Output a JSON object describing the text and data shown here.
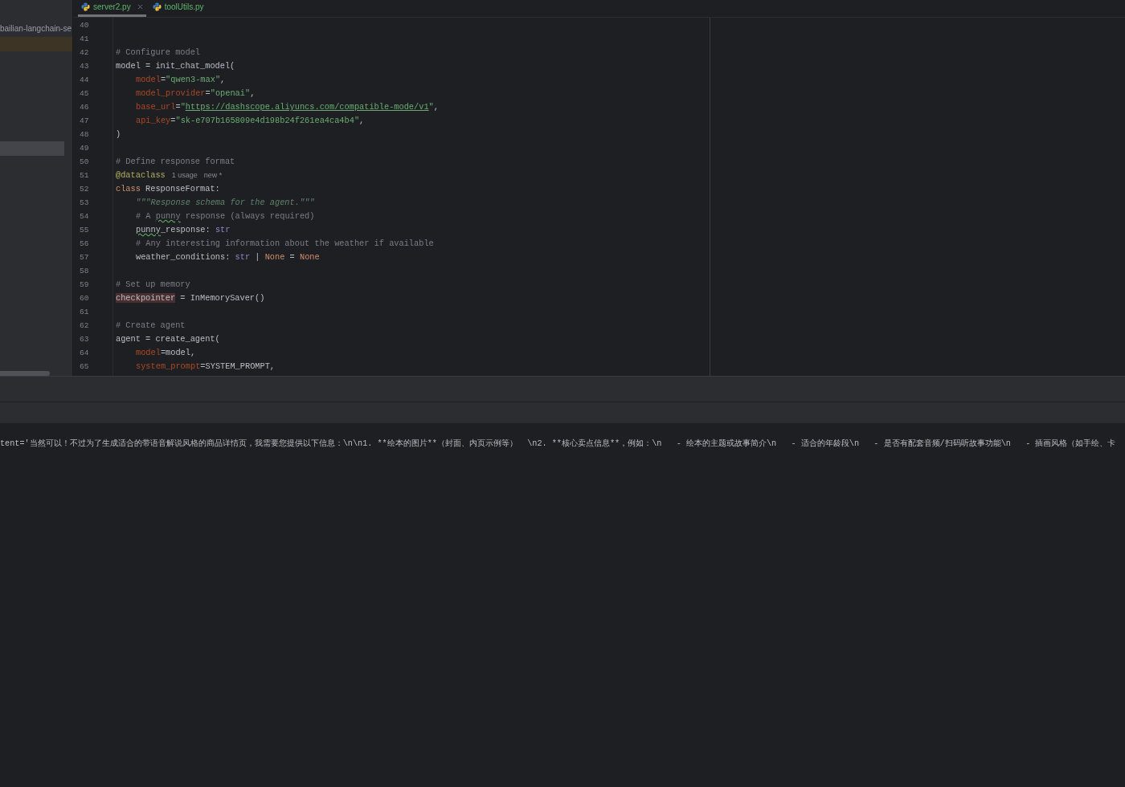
{
  "tabs": [
    {
      "label": "server2.py",
      "selected": true,
      "closable": true
    },
    {
      "label": "toolUtils.py",
      "selected": false,
      "closable": false
    }
  ],
  "project_tree": {
    "root_label": "bailian-langchain-se",
    "rows": [
      {
        "selected": false
      },
      {
        "selected": true
      }
    ]
  },
  "editor": {
    "lines": [
      {
        "number": "40"
      },
      {
        "number": "41"
      },
      {
        "number": "42",
        "indented": false,
        "tokens": [
          {
            "t": "# Configure model",
            "kind": "comment"
          }
        ]
      },
      {
        "number": "43",
        "indented": false,
        "tokens": [
          {
            "t": "model = init_chat_model(",
            "kind": "plain"
          }
        ]
      },
      {
        "number": "44",
        "indented": true,
        "tokens": [
          {
            "t": "model",
            "kind": "param"
          },
          {
            "t": "=",
            "kind": "plain"
          },
          {
            "t": "\"qwen3-max\"",
            "kind": "string"
          },
          {
            "t": ",",
            "kind": "plain"
          }
        ]
      },
      {
        "number": "45",
        "indented": true,
        "tokens": [
          {
            "t": "model_provider",
            "kind": "param"
          },
          {
            "t": "=",
            "kind": "plain"
          },
          {
            "t": "\"openai\"",
            "kind": "string"
          },
          {
            "t": ",",
            "kind": "plain"
          }
        ]
      },
      {
        "number": "46",
        "indented": true,
        "tokens": [
          {
            "t": "base_url",
            "kind": "param"
          },
          {
            "t": "=",
            "kind": "plain"
          },
          {
            "t": "\"",
            "kind": "string"
          },
          {
            "t": "https://dashscope.aliyuncs.com/compatible-mode/v1",
            "kind": "url"
          },
          {
            "t": "\"",
            "kind": "string"
          },
          {
            "t": ",",
            "kind": "plain"
          }
        ]
      },
      {
        "number": "47",
        "indented": true,
        "tokens": [
          {
            "t": "api_key",
            "kind": "param"
          },
          {
            "t": "=",
            "kind": "plain"
          },
          {
            "t": "\"sk-e707b165809e4d198b24f261ea4ca4b4\"",
            "kind": "string"
          },
          {
            "t": ",",
            "kind": "plain"
          }
        ]
      },
      {
        "number": "48",
        "indented": false,
        "tokens": [
          {
            "t": ")",
            "kind": "plain"
          }
        ]
      },
      {
        "number": "49"
      },
      {
        "number": "50",
        "indented": false,
        "tokens": [
          {
            "t": "# Define response format",
            "kind": "comment"
          }
        ]
      },
      {
        "number": "51",
        "indented": false,
        "tokens": [
          {
            "t": "@dataclass",
            "kind": "decorator"
          },
          {
            "t": "1 usage",
            "kind": "hint"
          },
          {
            "t": "new *",
            "kind": "hint"
          }
        ]
      },
      {
        "number": "52",
        "indented": false,
        "tokens": [
          {
            "t": "class",
            "kind": "keyword"
          },
          {
            "t": " ResponseFormat:",
            "kind": "plain"
          }
        ]
      },
      {
        "number": "53",
        "indented": true,
        "tokens": [
          {
            "t": "\"\"\"Response schema for the agent.\"\"\"",
            "kind": "docstring"
          }
        ]
      },
      {
        "number": "54",
        "indented": true,
        "tokens": [
          {
            "t": "# A ",
            "kind": "comment"
          },
          {
            "t": "punny",
            "kind": "typo_comment"
          },
          {
            "t": " response (always required)",
            "kind": "comment"
          }
        ]
      },
      {
        "number": "55",
        "indented": true,
        "tokens": [
          {
            "t": "punny",
            "kind": "typo"
          },
          {
            "t": "_response: ",
            "kind": "plain"
          },
          {
            "t": "str",
            "kind": "builtin"
          }
        ]
      },
      {
        "number": "56",
        "indented": true,
        "tokens": [
          {
            "t": "# Any interesting information about the weather if available",
            "kind": "comment"
          }
        ]
      },
      {
        "number": "57",
        "indented": true,
        "tokens": [
          {
            "t": "weather_conditions: ",
            "kind": "plain"
          },
          {
            "t": "str",
            "kind": "builtin"
          },
          {
            "t": " | ",
            "kind": "plain"
          },
          {
            "t": "None",
            "kind": "const"
          },
          {
            "t": " = ",
            "kind": "plain"
          },
          {
            "t": "None",
            "kind": "const"
          }
        ]
      },
      {
        "number": "58"
      },
      {
        "number": "59",
        "indented": false,
        "tokens": [
          {
            "t": "# Set up memory",
            "kind": "comment"
          }
        ]
      },
      {
        "number": "60",
        "indented": false,
        "tokens": [
          {
            "t": "checkpointer",
            "kind": "marked"
          },
          {
            "t": " = InMemorySaver()",
            "kind": "plain"
          }
        ]
      },
      {
        "number": "61"
      },
      {
        "number": "62",
        "indented": false,
        "tokens": [
          {
            "t": "# Create agent",
            "kind": "comment"
          }
        ]
      },
      {
        "number": "63",
        "indented": false,
        "tokens": [
          {
            "t": "agent = create_agent(",
            "kind": "plain"
          }
        ]
      },
      {
        "number": "64",
        "indented": true,
        "tokens": [
          {
            "t": "model",
            "kind": "param"
          },
          {
            "t": "=model,",
            "kind": "plain"
          }
        ]
      },
      {
        "number": "65",
        "indented": true,
        "tokens": [
          {
            "t": "system_prompt",
            "kind": "param"
          },
          {
            "t": "=SYSTEM_PROMPT,",
            "kind": "plain"
          }
        ]
      }
    ]
  },
  "console": {
    "output": "tent='当然可以！不过为了生成适合的带语音解说风格的商品详情页，我需要您提供以下信息：\\n\\n1. **绘本的图片**（封面、内页示例等）  \\n2. **核心卖点信息**，例如：\\n   - 绘本的主题或故事简介\\n   - 适合的年龄段\\n   - 是否有配套音频/扫码听故事功能\\n   - 插画风格（如手绘、卡"
  }
}
